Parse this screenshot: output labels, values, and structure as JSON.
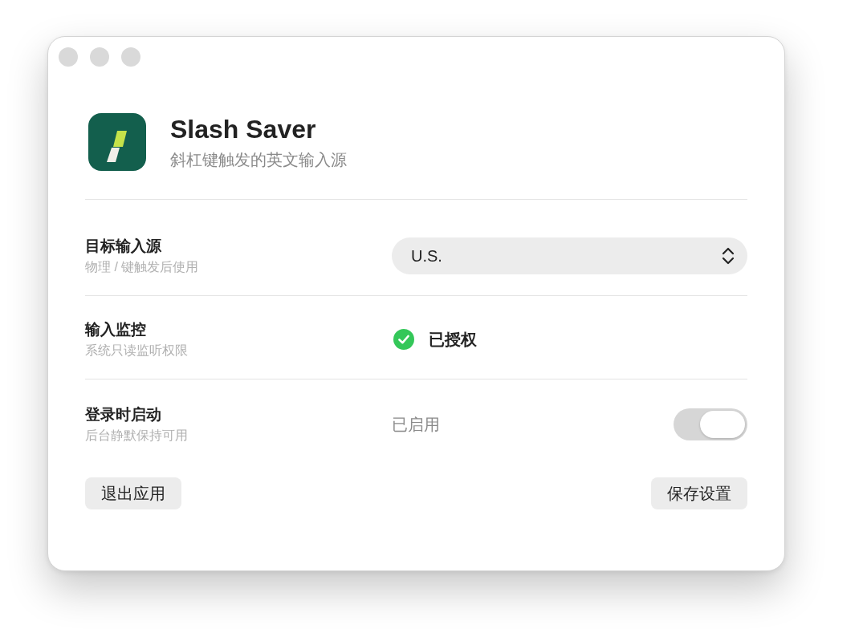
{
  "app": {
    "name": "Slash Saver",
    "subtitle": "斜杠键触发的英文输入源"
  },
  "settings": [
    {
      "kind": "select",
      "label": "目标输入源",
      "hint": "物理 / 键触发后使用",
      "value": "U.S."
    },
    {
      "kind": "status",
      "label": "输入监控",
      "hint": "系统只读监听权限",
      "status": "已授权",
      "granted": true
    },
    {
      "kind": "toggle",
      "label": "登录时启动",
      "hint": "后台静默保持可用",
      "status": "已启用",
      "on": true
    }
  ],
  "buttons": [
    {
      "label": "退出应用"
    },
    {
      "label": "保存设置"
    }
  ]
}
